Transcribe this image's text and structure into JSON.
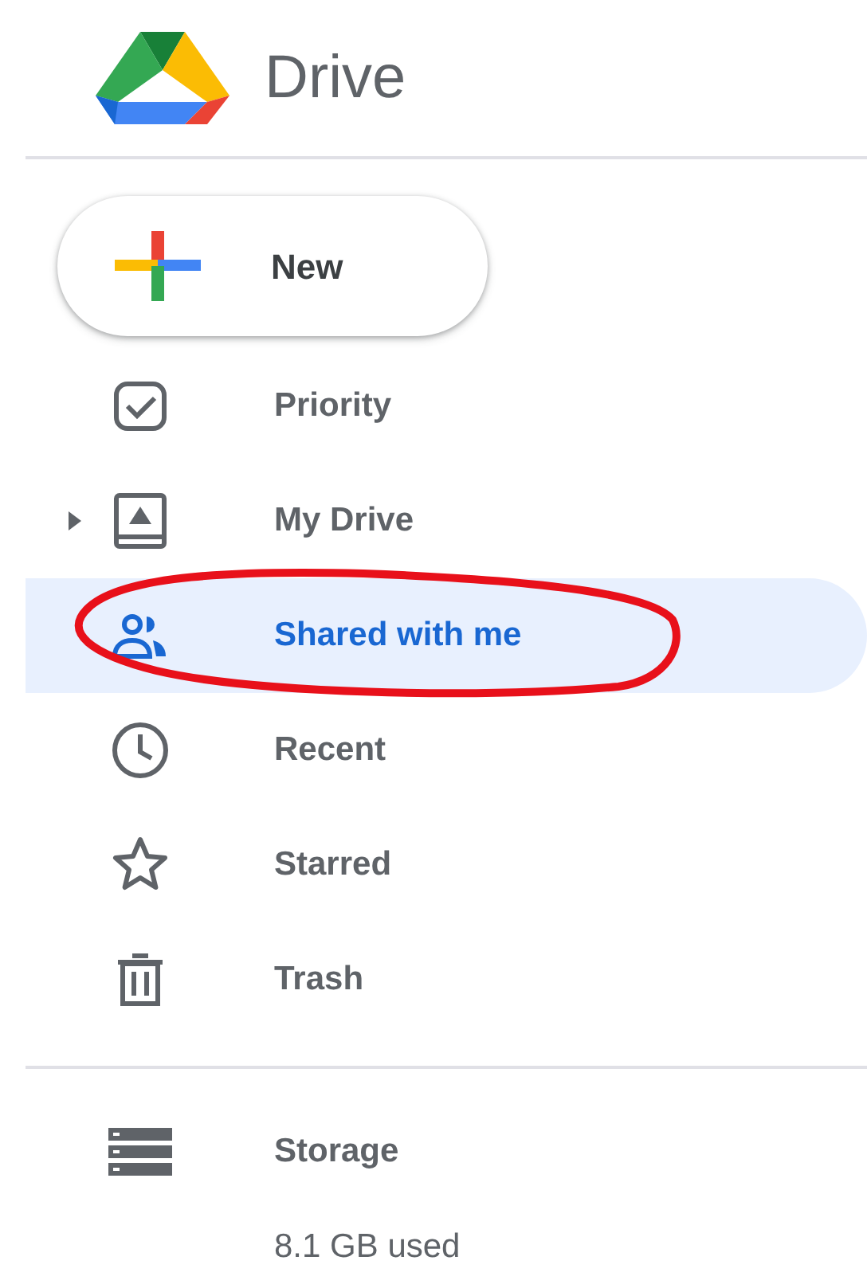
{
  "app": {
    "title": "Drive"
  },
  "new_button": {
    "label": "New"
  },
  "nav_items": [
    {
      "label": "Priority",
      "selected": false
    },
    {
      "label": "My Drive",
      "selected": false,
      "expanded": false
    },
    {
      "label": "Shared with me",
      "selected": true
    },
    {
      "label": "Recent",
      "selected": false
    },
    {
      "label": "Starred",
      "selected": false
    },
    {
      "label": "Trash",
      "selected": false
    }
  ],
  "storage": {
    "label": "Storage",
    "usage": "8.1 GB used"
  }
}
